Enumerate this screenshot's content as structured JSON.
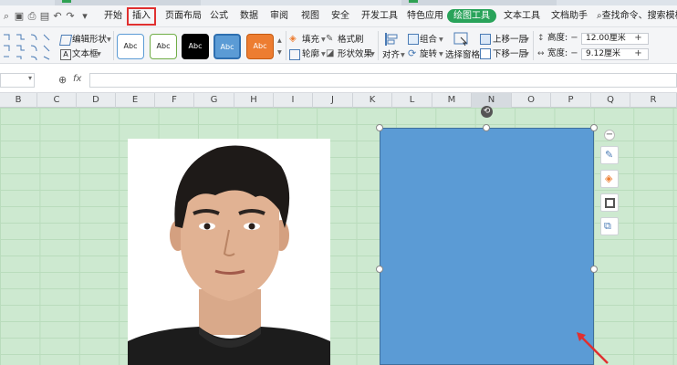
{
  "menu": {
    "items": [
      "开始",
      "插入",
      "页面布局",
      "公式",
      "数据",
      "审阅",
      "视图",
      "安全",
      "开发工具",
      "特色应用",
      "绘图工具",
      "文本工具",
      "文档助手"
    ],
    "search": "查找命令、搜索模板"
  },
  "ribbon": {
    "edit_shape": "编辑形状",
    "text_box": "文本框",
    "styles": [
      "Abc",
      "Abc",
      "Abc",
      "Abc",
      "Abc"
    ],
    "fill": "填充",
    "format_painter": "格式刷",
    "outline": "轮廓",
    "shape_effects": "形状效果",
    "align": "对齐",
    "group": "组合",
    "rotate": "旋转",
    "selection_pane": "选择窗格",
    "bring_forward": "上移一层",
    "send_backward": "下移一层",
    "height_label": "高度:",
    "height_value": "12.00厘米",
    "width_label": "宽度:",
    "width_value": "9.12厘米"
  },
  "formula_bar": {
    "fx": "fx"
  },
  "columns": [
    "B",
    "C",
    "D",
    "E",
    "F",
    "G",
    "H",
    "I",
    "J",
    "K",
    "L",
    "M",
    "N",
    "O",
    "P",
    "Q",
    "R"
  ],
  "selected_column": "N",
  "colors": {
    "accent": "#29a35a",
    "highlight": "#e03030",
    "shape_fill": "#5b9bd5",
    "sheet_bg": "#cde9d0"
  }
}
